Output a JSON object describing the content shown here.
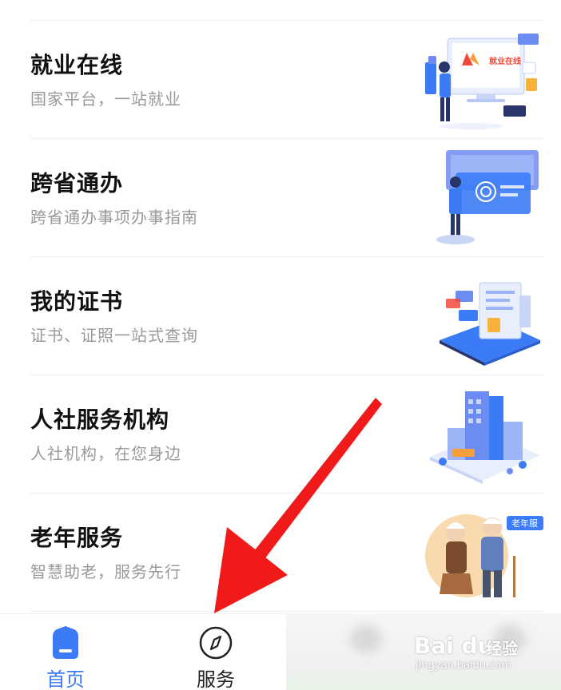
{
  "services": [
    {
      "title": "就业在线",
      "subtitle": "国家平台，一站就业",
      "illustration": "job-online-illustration",
      "illustration_text": "就业在线"
    },
    {
      "title": "跨省通办",
      "subtitle": "跨省通办事项办事指南",
      "illustration": "cross-province-illustration"
    },
    {
      "title": "我的证书",
      "subtitle": "证书、证照一站式查询",
      "illustration": "certificate-illustration"
    },
    {
      "title": "人社服务机构",
      "subtitle": "人社机构，在您身边",
      "illustration": "service-institution-illustration"
    },
    {
      "title": "老年服务",
      "subtitle": "智慧助老，服务先行",
      "illustration": "elderly-service-illustration",
      "badge": "老年服"
    }
  ],
  "tabs": [
    {
      "label": "首页",
      "icon": "home-icon",
      "color": "#3b7cf6",
      "active": true
    },
    {
      "label": "服务",
      "icon": "compass-icon",
      "color": "#222222",
      "active": false
    }
  ],
  "annotation": {
    "type": "red-arrow",
    "color": "#f01a1a",
    "points_to": "服务"
  },
  "watermark": {
    "logo": "Bai du",
    "name": "经验",
    "url": "jingyan.baidu.com"
  },
  "colors": {
    "accent": "#3b7cf6",
    "divider": "#ececec",
    "title": "#111111",
    "subtitle": "#999999"
  }
}
